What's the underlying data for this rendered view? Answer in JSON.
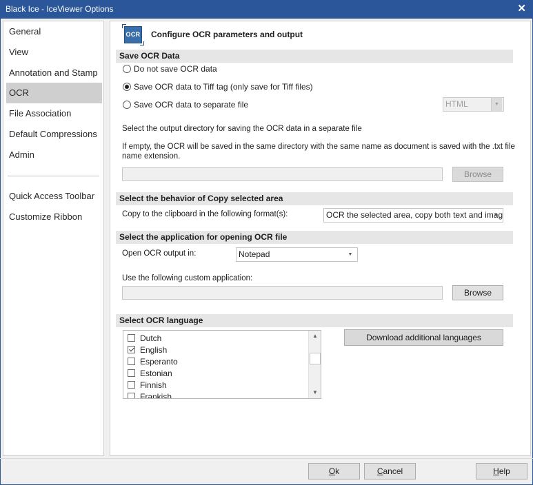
{
  "window": {
    "title": "Black Ice - IceViewer Options",
    "close_glyph": "✕",
    "accent_color": "#2b579a"
  },
  "sidebar": {
    "items": [
      {
        "label": "General"
      },
      {
        "label": "View"
      },
      {
        "label": "Annotation and Stamp"
      },
      {
        "label": "OCR",
        "selected": true
      },
      {
        "label": "File Association"
      },
      {
        "label": "Default Compressions"
      },
      {
        "label": "Admin"
      },
      {
        "label": "Quick Access Toolbar"
      },
      {
        "label": "Customize Ribbon"
      }
    ]
  },
  "header": {
    "icon": "ocr-icon",
    "icon_text": "OCR",
    "title": "Configure OCR parameters and output"
  },
  "save_ocr": {
    "section_title": "Save OCR Data",
    "options": [
      {
        "label": "Do not save OCR data",
        "checked": false
      },
      {
        "label": "Save OCR data to Tiff tag (only save for Tiff files)",
        "checked": true
      },
      {
        "label": "Save OCR data to separate file",
        "checked": false
      }
    ],
    "format_select": {
      "value": "HTML",
      "disabled": true
    },
    "output_dir_label": "Select the output directory for saving the OCR data in a separate file",
    "note": "If empty, the OCR will be saved in the same directory with the same name as document is saved with the .txt file name extension.",
    "path_value": "",
    "browse_label": "Browse"
  },
  "copy_area": {
    "section_title": "Select the behavior of Copy selected area",
    "label": "Copy to the clipboard in the following format(s):",
    "select_value": "OCR the selected area, copy both text and image"
  },
  "open_app": {
    "section_title": "Select the application for opening OCR file",
    "label": "Open OCR output in:",
    "select_value": "Notepad",
    "custom_label": "Use the following custom application:",
    "custom_value": "",
    "browse_label": "Browse"
  },
  "language": {
    "section_title": "Select OCR language",
    "items": [
      {
        "label": "Dutch",
        "checked": false
      },
      {
        "label": "English",
        "checked": true
      },
      {
        "label": "Esperanto",
        "checked": false
      },
      {
        "label": "Estonian",
        "checked": false
      },
      {
        "label": "Finnish",
        "checked": false
      },
      {
        "label": "Frankish",
        "checked": false
      }
    ],
    "download_label": "Download additional languages"
  },
  "footer": {
    "ok": {
      "mnemonic": "O",
      "rest": "k"
    },
    "cancel": {
      "mnemonic": "C",
      "rest": "ancel"
    },
    "help": {
      "mnemonic": "H",
      "rest": "elp"
    }
  }
}
